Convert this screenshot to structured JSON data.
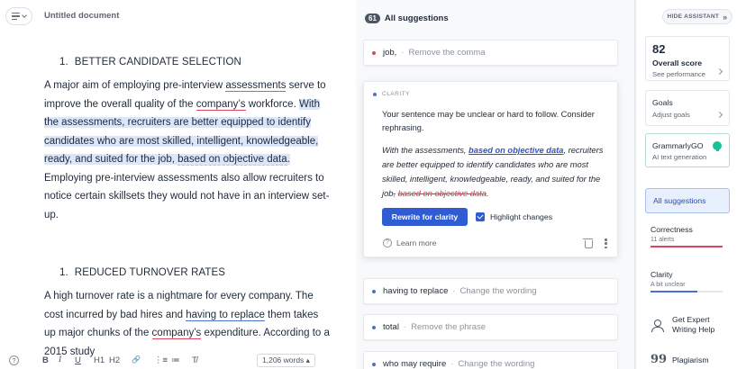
{
  "editor": {
    "doc_title": "Untitled document",
    "section1": {
      "num": "1.",
      "title": "BETTER CANDIDATE SELECTION"
    },
    "para1": {
      "a": "A major aim of employing pre-interview ",
      "assessments": "assessments",
      "b": " serve to improve the overall quality of the ",
      "company1": "company’s",
      "c": " workforce. ",
      "hl1": "With the assessments, recruiters are better equipped to identify candidates who are most skilled, intelligent, knowledgeable, ready, and suited for the job, ",
      "hl2": "based on objective data",
      "hl3": ".",
      "d": " Employing pre-interview assessments also allow recruiters to notice certain skillsets they would not have in an interview set-up."
    },
    "section2": {
      "num": "1.",
      "title": "REDUCED TURNOVER RATES"
    },
    "para2": {
      "a": "A high turnover rate is a nightmare for every company. The cost incurred by bad hires and ",
      "having": "having to replace",
      "b": " them takes up major chunks of the ",
      "company2": "company’s",
      "c": " expenditure. According to a 2015 study"
    },
    "toolbar": {
      "help": "?",
      "bold": "B",
      "italic": "I",
      "underline": "U",
      "h1": "H1",
      "h2": "H2",
      "link": "🔗",
      "ordered_list": "⋮≡",
      "bullet_list": "≔",
      "clear_format": "T̸",
      "word_count": "1,206 words ▴"
    }
  },
  "suggestions": {
    "count": "61",
    "title": "All suggestions",
    "cards": [
      {
        "word": "job,",
        "action": "Remove the comma",
        "dot_color": "#e0445a"
      },
      {
        "word": "having to replace",
        "action": "Change the wording",
        "dot_color": "#4a6fd6"
      },
      {
        "word": "total",
        "action": "Remove the phrase",
        "dot_color": "#4a6fd6"
      },
      {
        "word": "who may require",
        "action": "Change the wording",
        "dot_color": "#4a6fd6"
      }
    ],
    "expanded": {
      "category": "CLARITY",
      "message": "Your sentence may be unclear or hard to follow. Consider rephrasing.",
      "example_a": "With the assessments, ",
      "example_ins": "based on objective data",
      "example_b": ", recruiters are better equipped to identify candidates who are most skilled, intelligent, knowledgeable, ready, and suited for the job",
      "example_del_comma": ",",
      "example_del": "based on objective data",
      "example_c": ".",
      "rewrite_label": "Rewrite for clarity",
      "highlight_label": "Highlight changes",
      "learn_label": "Learn more",
      "learn_icon": "?"
    }
  },
  "assistant": {
    "hide_label": "HIDE ASSISTANT",
    "hide_icon": "»",
    "score": {
      "value": "82",
      "label": "Overall score",
      "sub": "See performance"
    },
    "goals": {
      "label": "Goals",
      "sub": "Adjust goals"
    },
    "go": {
      "label": "GrammarlyGO",
      "sub": "AI text generation"
    },
    "all_suggestions": "All suggestions",
    "correctness": {
      "label": "Correctness",
      "sub": "11 alerts",
      "color": "#e0445a",
      "level": 1.0
    },
    "clarity": {
      "label": "Clarity",
      "sub": "A bit unclear",
      "color": "#4a6fd6",
      "level": 0.65
    },
    "expert": {
      "label1": "Get Expert",
      "label2": "Writing Help"
    },
    "plagiarism": {
      "label": "Plagiarism",
      "icon": "99"
    }
  }
}
